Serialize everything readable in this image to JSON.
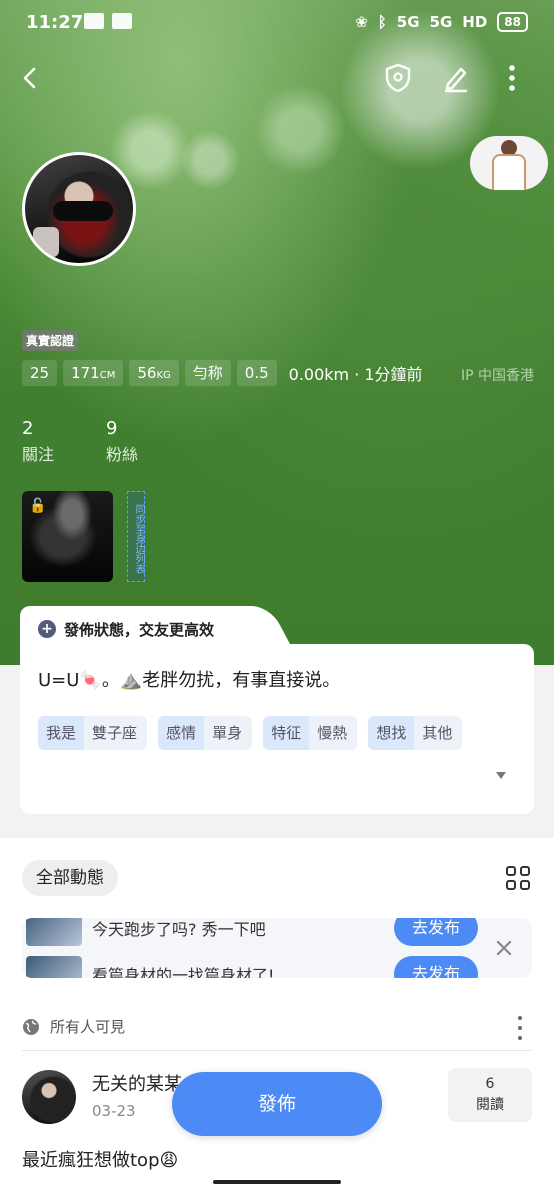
{
  "status_bar": {
    "time": "11:27",
    "network_label": "5G",
    "hd_label": "HD",
    "battery": "88"
  },
  "profile": {
    "verified_badge": "真實認證",
    "stats": {
      "age": "25",
      "height": "171",
      "height_unit": "CM",
      "weight": "56",
      "weight_unit": "KG",
      "body_type": "勻称",
      "role": "0.5"
    },
    "distance_time": "0.00km · 1分鐘前",
    "ip_location": "IP 中国香港",
    "following_count": "2",
    "following_label": "關注",
    "followers_count": "9",
    "followers_label": "粉絲",
    "sync_tag": "同步至身边列表"
  },
  "status_card": {
    "tab_title": "發佈狀態，交友更高效",
    "text": "U=U🍬。⛰️老胖勿扰，有事直接说。",
    "tags": [
      {
        "key": "我是",
        "value": "雙子座"
      },
      {
        "key": "感情",
        "value": "單身"
      },
      {
        "key": "特征",
        "value": "慢熱"
      },
      {
        "key": "想找",
        "value": "其他"
      }
    ]
  },
  "feed": {
    "filter_label": "全部動態",
    "banner": {
      "row1_text": "今天跑步了吗? 秀一下吧",
      "row1_button": "去发布",
      "row2_text": "看篇身材的一找篇身材了!",
      "row2_button": "去发布"
    },
    "visibility": "所有人可見",
    "post": {
      "author": "无关的某某",
      "date": "03-23",
      "reads_count": "6",
      "reads_label": "閱讀",
      "text": "最近瘋狂想做top😩"
    },
    "publish_button": "發佈"
  },
  "icons": {
    "back": "chevron-left-icon",
    "shield": "shield-icon",
    "edit": "pencil-icon",
    "more": "more-vertical-icon",
    "lock": "unlock-icon",
    "grid": "grid-icon",
    "globe": "globe-icon",
    "close": "close-icon"
  },
  "colors": {
    "accent": "#4c8bf5",
    "hero_green": "#3f7d2e",
    "tag_key_bg": "#dbe7fa"
  }
}
